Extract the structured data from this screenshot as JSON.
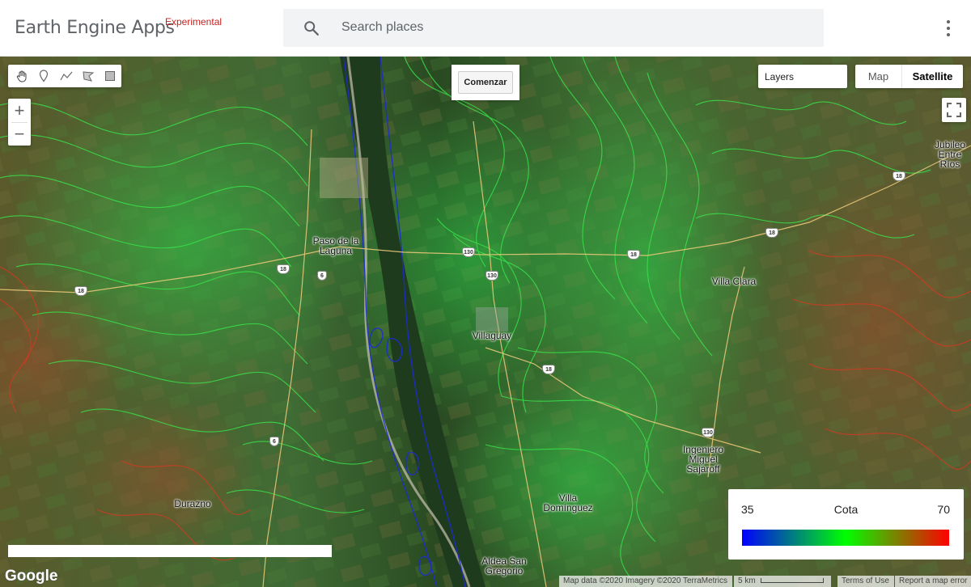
{
  "app": {
    "title": "Earth Engine Apps",
    "tag": "Experimental",
    "search_placeholder": "Search places"
  },
  "map": {
    "comenzar_label": "Comenzar",
    "layers_label": "Layers",
    "map_type": {
      "map_label": "Map",
      "satellite_label": "Satellite",
      "selected": "Satellite"
    },
    "zoom": {
      "in_label": "+",
      "out_label": "−"
    },
    "drawing_tools": [
      "pan-hand-icon",
      "point-marker-icon",
      "line-icon",
      "polygon-icon",
      "rectangle-icon"
    ],
    "places": {
      "paso": "Paso de la Laguna",
      "villaguay": "Villaguay",
      "villa_clara": "Villa Clara",
      "jubileo": "Jubileo Entre Ríos",
      "ingeniero": "Ingeniero Miguel Sajaroff",
      "durazno": "Durazno",
      "villa_dominguez": "Villa Domínguez",
      "aldea": "Aldea San Gregorio"
    },
    "routes": {
      "r1": "18",
      "r2": "18",
      "r3": "130",
      "r4": "18",
      "r5": "18",
      "r6": "130",
      "r7": "6",
      "r8": "18",
      "r9": "130",
      "r10": "6",
      "r11": "18"
    },
    "google_logo": "Google",
    "attribution": {
      "data": "Map data ©2020 Imagery ©2020 TerraMetrics",
      "scale": "5 km",
      "terms": "Terms of Use",
      "report": "Report a map error"
    }
  },
  "legend": {
    "title": "Cota",
    "min": "35",
    "max": "70",
    "palette": [
      "#0000ff",
      "#00ff00",
      "#ff0000"
    ]
  }
}
